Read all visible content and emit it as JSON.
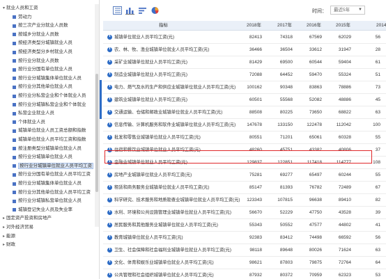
{
  "tree": {
    "items": [
      {
        "label": "就业人员和工资",
        "level": 0,
        "expanded": true
      },
      {
        "label": "劳动力",
        "level": 1
      },
      {
        "label": "按三次产业分就业人员数",
        "level": 1
      },
      {
        "label": "按城乡分就业人员数",
        "level": 1
      },
      {
        "label": "按经济类型分城镇就业人员",
        "level": 1
      },
      {
        "label": "按经济类型分乡村就业人员",
        "level": 1
      },
      {
        "label": "按行业分就业人员数",
        "level": 1
      },
      {
        "label": "按行业分国有单位就业人员",
        "level": 1
      },
      {
        "label": "按行业分城镇集体单位就业人员",
        "level": 1
      },
      {
        "label": "按行业分其他单位就业人员",
        "level": 1
      },
      {
        "label": "按行业分私营企业和个体就业人员",
        "level": 1
      },
      {
        "label": "按行业分城镇私营企业和个体就业",
        "level": 1
      },
      {
        "label": "私营企业就业人员",
        "level": 1
      },
      {
        "label": "个体就业人员",
        "level": 1
      },
      {
        "label": "城镇单位就业人员工资总额和指数",
        "level": 1
      },
      {
        "label": "城镇单位就业人员平均工资和指数",
        "level": 1
      },
      {
        "label": "按注册类型分城镇单位就业人员",
        "level": 1
      },
      {
        "label": "按行业分城镇单位就业人员",
        "level": 1
      },
      {
        "label": "按行业分城镇单位就业人员平均工资",
        "level": 1,
        "selected": true
      },
      {
        "label": "按行业分国有单位就业人员平均工资",
        "level": 1
      },
      {
        "label": "按行业分城镇集体单位就业人员",
        "level": 1
      },
      {
        "label": "按行业分其他单位就业人员平均工资",
        "level": 1
      },
      {
        "label": "按行业分城镇私营单位就业人员",
        "level": 1
      },
      {
        "label": "城镇登记失业人员及失业率",
        "level": 1
      },
      {
        "label": "固定资产投资和房地产",
        "level": 0,
        "expanded": false
      },
      {
        "label": "对外经济贸易",
        "level": 0,
        "expanded": false
      },
      {
        "label": "能源",
        "level": 0,
        "expanded": false
      },
      {
        "label": "财政",
        "level": 0,
        "expanded": false
      }
    ]
  },
  "toolbar": {
    "icons": [
      "table-icon",
      "bar-chart-icon",
      "sort-icon",
      "pie-chart-icon"
    ],
    "time_label": "时间：",
    "time_value": "最近5年"
  },
  "table": {
    "headers": [
      "指标",
      "2018年",
      "2017年",
      "2016年",
      "2015年",
      "2014"
    ],
    "rows": [
      {
        "name": "城镇单位就业人员平均工资(元)",
        "values": [
          "82413",
          "74318",
          "67569",
          "62029",
          "56"
        ]
      },
      {
        "name": "农、林、牧、渔业城镇单位就业人员平均工资(元)",
        "values": [
          "36466",
          "36504",
          "33612",
          "31947",
          "28"
        ]
      },
      {
        "name": "采矿业城镇单位就业人员平均工资(元)",
        "values": [
          "81429",
          "69500",
          "60544",
          "59404",
          "61"
        ]
      },
      {
        "name": "制造业城镇单位就业人员平均工资(元)",
        "values": [
          "72088",
          "64452",
          "59470",
          "55324",
          "51"
        ]
      },
      {
        "name": "电力、燃气及水的生产和供应业城镇单位就业人员平均工资(元)",
        "values": [
          "100162",
          "90348",
          "83863",
          "78886",
          "73"
        ]
      },
      {
        "name": "建筑业城镇单位就业人员平均工资(元)",
        "values": [
          "60501",
          "55568",
          "52082",
          "48886",
          "45"
        ]
      },
      {
        "name": "交通运输、仓储和邮政业城镇单位就业人员平均工资(元)",
        "values": [
          "88508",
          "80225",
          "73650",
          "68822",
          "63"
        ]
      },
      {
        "name": "信息传输、计算机服务和软件业城镇单位就业人员平均工资(元)",
        "values": [
          "147678",
          "133150",
          "122478",
          "112042",
          "100"
        ]
      },
      {
        "name": "批发和零售业城镇单位就业人员平均工资(元)",
        "values": [
          "80551",
          "71201",
          "65061",
          "60328",
          "55"
        ]
      },
      {
        "name": "住宿和餐饮业城镇单位就业人员平均工资(元)",
        "values": [
          "48260",
          "45751",
          "43382",
          "40806",
          "37"
        ]
      },
      {
        "name": "金融业城镇单位就业人员平均工资(元)",
        "values": [
          "129837",
          "122851",
          "117418",
          "114777",
          "108"
        ]
      },
      {
        "name": "房地产业城镇单位就业人员平均工资(元)",
        "values": [
          "75281",
          "69277",
          "65497",
          "60244",
          "55"
        ]
      },
      {
        "name": "租赁和商务服务业城镇单位就业人员平均工资(元)",
        "values": [
          "85147",
          "81393",
          "76782",
          "72489",
          "67"
        ]
      },
      {
        "name": "科学研究、技术服务和地质勘查业城镇单位就业人员平均工资(元)",
        "values": [
          "123343",
          "107815",
          "96638",
          "89410",
          "82"
        ]
      },
      {
        "name": "水利、环境和公共设施管理业城镇单位就业人员平均工资(元)",
        "values": [
          "56670",
          "52229",
          "47750",
          "43528",
          "39"
        ]
      },
      {
        "name": "居民服务和其他服务业城镇单位就业人员平均工资(元)",
        "values": [
          "55343",
          "50552",
          "47577",
          "44802",
          "41"
        ]
      },
      {
        "name": "教育城镇单位就业人员平均工资(元)",
        "values": [
          "92383",
          "83412",
          "74498",
          "66592",
          "56"
        ]
      },
      {
        "name": "卫生、社会保障和社会福利业城镇单位就业人员平均工资(元)",
        "values": [
          "98118",
          "89648",
          "80026",
          "71624",
          "63"
        ]
      },
      {
        "name": "文化、体育和娱乐业城镇单位就业人员平均工资(元)",
        "values": [
          "98621",
          "87803",
          "79875",
          "72764",
          "64"
        ]
      },
      {
        "name": "公共管理和社会组织城镇单位就业人员平均工资(元)",
        "values": [
          "87932",
          "80372",
          "70959",
          "62323",
          "53"
        ]
      }
    ]
  },
  "colors": {
    "accent": "#2d6cc6",
    "highlight": "#e0282a",
    "header_bg": "#eaf0f8"
  }
}
